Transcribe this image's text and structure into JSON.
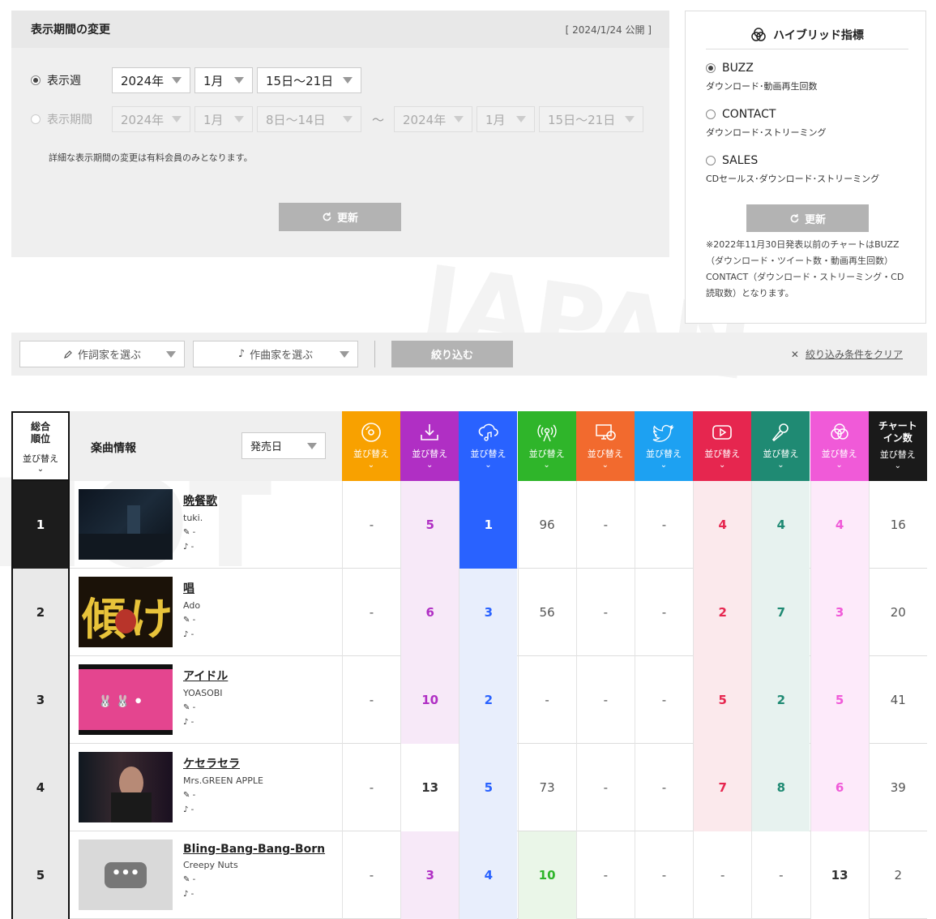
{
  "period": {
    "title": "表示期間の変更",
    "published": "[ 2024/1/24 公開 ]",
    "week_label": "表示週",
    "range_label": "表示期間",
    "week": {
      "year": "2024年",
      "month": "1月",
      "days": "15日〜21日"
    },
    "range_from": {
      "year": "2024年",
      "month": "1月",
      "days": "8日〜14日"
    },
    "range_sep": "〜",
    "range_to": {
      "year": "2024年",
      "month": "1月",
      "days": "15日〜21日"
    },
    "note": "詳細な表示期間の変更は有料会員のみとなります。",
    "update_label": "更新"
  },
  "hybrid": {
    "title": "ハイブリッド指標",
    "options": [
      {
        "name": "BUZZ",
        "desc": "ダウンロード･動画再生回数",
        "selected": true
      },
      {
        "name": "CONTACT",
        "desc": "ダウンロード･ストリーミング",
        "selected": false
      },
      {
        "name": "SALES",
        "desc": "CDセールス･ダウンロード･ストリーミング",
        "selected": false
      }
    ],
    "update_label": "更新",
    "note": "※2022年11月30日発表以前のチャートはBUZZ（ダウンロード・ツイート数・動画再生回数）CONTACT（ダウンロード・ストリーミング・CD読取数）となります。"
  },
  "filter": {
    "lyricist_label": "作詞家を選ぶ",
    "composer_label": "作曲家を選ぶ",
    "apply_label": "絞り込む",
    "clear_label": "絞り込み条件をクリア"
  },
  "table": {
    "rank_header": "総合\n順位",
    "sort_label": "並び替え",
    "info_header": "楽曲情報",
    "release_sort": "発売日",
    "last_header": "チャート\nイン数",
    "metrics": [
      {
        "icon": "cd-icon",
        "color": "#f8a100"
      },
      {
        "icon": "download-icon",
        "color": "#b02fc4"
      },
      {
        "icon": "streaming-icon",
        "color": "#2962ff"
      },
      {
        "icon": "radio-icon",
        "color": "#2fb52a"
      },
      {
        "icon": "pc-icon",
        "color": "#f26a2e"
      },
      {
        "icon": "twitter-icon",
        "color": "#1da1f2"
      },
      {
        "icon": "youtube-icon",
        "color": "#e6264f"
      },
      {
        "icon": "karaoke-icon",
        "color": "#1f8a73"
      },
      {
        "icon": "hybrid-icon",
        "color": "#f05ad8"
      },
      {
        "icon": "none",
        "color": "#1a1a1a"
      }
    ],
    "rows": [
      {
        "rank": "1",
        "title": "晩餐歌",
        "artist": "tuki.",
        "lyricist": "-",
        "composer": "-",
        "values": [
          "-",
          "5",
          "1",
          "96",
          "-",
          "-",
          "4",
          "4",
          "4",
          "16"
        ]
      },
      {
        "rank": "2",
        "title": "唱",
        "artist": "Ado",
        "lyricist": "-",
        "composer": "-",
        "values": [
          "-",
          "6",
          "3",
          "56",
          "-",
          "-",
          "2",
          "7",
          "3",
          "20"
        ]
      },
      {
        "rank": "3",
        "title": "アイドル",
        "artist": "YOASOBI",
        "lyricist": "-",
        "composer": "-",
        "values": [
          "-",
          "10",
          "2",
          "-",
          "-",
          "-",
          "5",
          "2",
          "5",
          "41"
        ]
      },
      {
        "rank": "4",
        "title": "ケセラセラ",
        "artist": "Mrs.GREEN APPLE",
        "lyricist": "-",
        "composer": "-",
        "values": [
          "-",
          "13",
          "5",
          "73",
          "-",
          "-",
          "7",
          "8",
          "6",
          "39"
        ]
      },
      {
        "rank": "5",
        "title": "Bling-Bang-Bang-Born",
        "artist": "Creepy Nuts",
        "lyricist": "-",
        "composer": "-",
        "values": [
          "-",
          "3",
          "4",
          "10",
          "-",
          "-",
          "-",
          "-",
          "13",
          "2"
        ]
      }
    ]
  }
}
